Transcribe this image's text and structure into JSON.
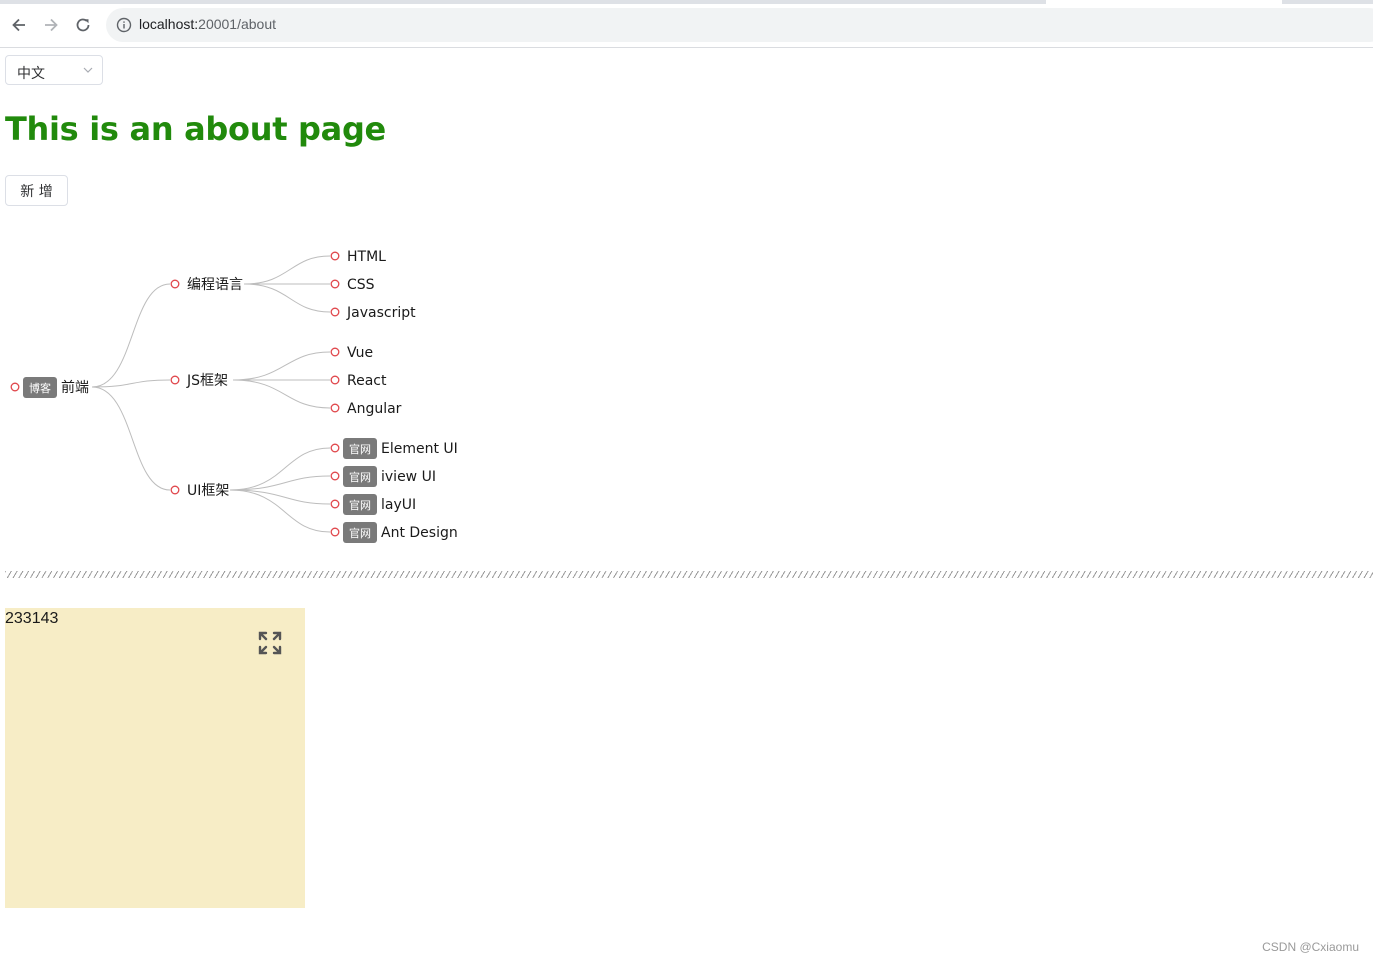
{
  "browser": {
    "url_host": "localhost:",
    "url_rest": "20001/about"
  },
  "language_select": {
    "value": "中文"
  },
  "page": {
    "title": "This is an about page",
    "add_button": "新 增"
  },
  "mindmap": {
    "root": {
      "tag": "博客",
      "label": "前端"
    },
    "branches": [
      {
        "label": "编程语言",
        "children": [
          {
            "label": "HTML"
          },
          {
            "label": "CSS"
          },
          {
            "label": "Javascript"
          }
        ]
      },
      {
        "label": "JS框架",
        "children": [
          {
            "label": "Vue"
          },
          {
            "label": "React"
          },
          {
            "label": "Angular"
          }
        ]
      },
      {
        "label": "UI框架",
        "children": [
          {
            "tag": "官网",
            "label": "Element UI"
          },
          {
            "tag": "官网",
            "label": "iview UI"
          },
          {
            "tag": "官网",
            "label": "layUI"
          },
          {
            "tag": "官网",
            "label": "Ant Design"
          }
        ]
      }
    ]
  },
  "panel": {
    "value": "233143"
  },
  "watermark": "CSDN @Cxiaomu",
  "colors": {
    "title": "#218a0c",
    "node_circle": "#e0474c",
    "tag_bg": "#7a7a7a",
    "panel_bg": "#f7edc6"
  }
}
